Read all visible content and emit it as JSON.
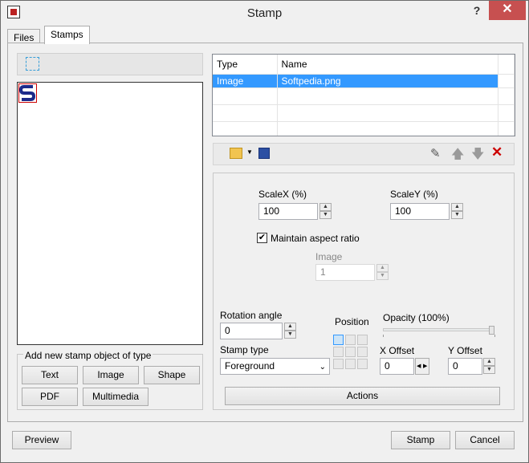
{
  "window": {
    "title": "Stamp",
    "help": "?",
    "close": "✕"
  },
  "tabs": [
    {
      "label": "Files"
    },
    {
      "label": "Stamps"
    }
  ],
  "stamp_list": {
    "columns": [
      "Type",
      "Name"
    ],
    "rows": [
      {
        "type": "Image",
        "name": "Softpedia.png"
      }
    ]
  },
  "add_group": {
    "title": "Add new stamp object of type",
    "buttons": [
      "Text",
      "Image",
      "Shape",
      "PDF",
      "Multimedia"
    ]
  },
  "props": {
    "scalex_label": "ScaleX (%)",
    "scalex_value": "100",
    "scaley_label": "ScaleY (%)",
    "scaley_value": "100",
    "maintain_label": "Maintain aspect ratio",
    "maintain_checked": true,
    "image_label": "Image",
    "image_value": "1",
    "rotation_label": "Rotation angle",
    "rotation_value": "0",
    "position_label": "Position",
    "opacity_label": "Opacity (100%)",
    "opacity_value": 1.0,
    "stamp_type_label": "Stamp type",
    "stamp_type_value": "Foreground",
    "xoffset_label": "X Offset",
    "xoffset_value": "0",
    "yoffset_label": "Y Offset",
    "yoffset_value": "0",
    "actions_label": "Actions"
  },
  "footer": {
    "preview": "Preview",
    "stamp": "Stamp",
    "cancel": "Cancel"
  },
  "colors": {
    "selection": "#3399ff",
    "close_red": "#c75050",
    "delete_red": "#cc0000"
  }
}
